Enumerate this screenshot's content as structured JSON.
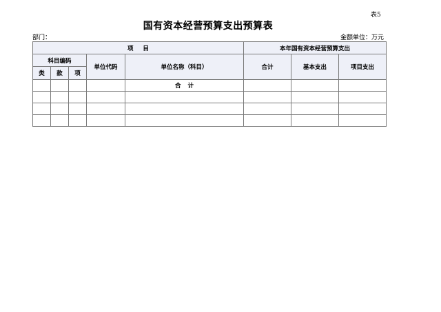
{
  "header": {
    "table_no": "表5",
    "title": "国有资本经营预算支出预算表",
    "department_label": "部门：",
    "unit_label": "金额单位：万元"
  },
  "table": {
    "group_item": "项目",
    "group_budget": "本年国有资本经营预算支出",
    "subject_code": "科目编码",
    "col_class": "类",
    "col_section": "款",
    "col_item": "项",
    "col_unit_code": "单位代码",
    "col_unit_name": "单位名称（科目）",
    "col_total": "合计",
    "col_basic": "基本支出",
    "col_project": "项目支出",
    "rows": [
      {
        "class": "",
        "section": "",
        "item": "",
        "unit_code": "",
        "unit_name": "合计",
        "total": "",
        "basic": "",
        "project": ""
      },
      {
        "class": "",
        "section": "",
        "item": "",
        "unit_code": "",
        "unit_name": "",
        "total": "",
        "basic": "",
        "project": ""
      },
      {
        "class": "",
        "section": "",
        "item": "",
        "unit_code": "",
        "unit_name": "",
        "total": "",
        "basic": "",
        "project": ""
      },
      {
        "class": "",
        "section": "",
        "item": "",
        "unit_code": "",
        "unit_name": "",
        "total": "",
        "basic": "",
        "project": ""
      }
    ]
  }
}
